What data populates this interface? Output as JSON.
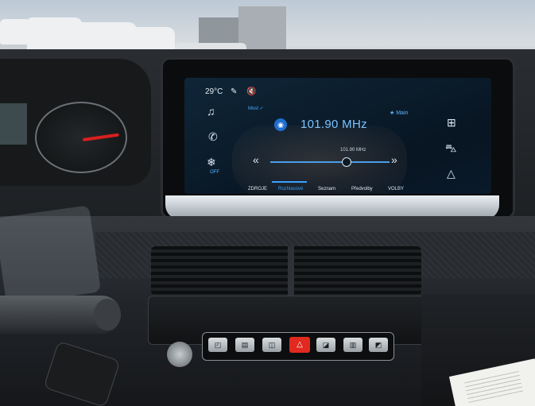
{
  "screen": {
    "status": {
      "temperature": "29°C"
    },
    "source_label": "Most ✓",
    "frequency": "101.90 MHz",
    "favourites_label": "★ Main",
    "preset_small_freq": "101.90 MHz",
    "tabs": [
      {
        "label": "ZDROJE",
        "active": false
      },
      {
        "label": "Rozhlasové",
        "active": true
      },
      {
        "label": "Seznam",
        "active": false
      },
      {
        "label": "Předvolby",
        "active": false
      },
      {
        "label": "VOLBY",
        "active": false
      }
    ],
    "left_icons": [
      "music-note-icon",
      "phone-icon",
      "climate-off-icon"
    ],
    "right_icons": [
      "grid-apps-icon",
      "car-icon",
      "navigation-icon"
    ],
    "off_label": "OFF",
    "accent_color": "#39a0ff"
  },
  "controls": {
    "hazard_icon": "△"
  }
}
